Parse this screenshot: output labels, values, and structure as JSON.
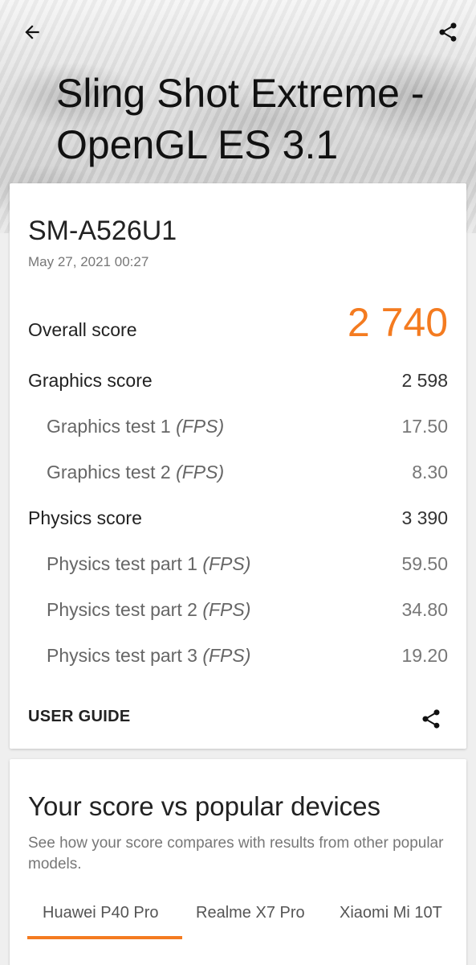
{
  "header": {
    "title": "Sling Shot Extreme - OpenGL ES 3.1",
    "back_icon": "arrow-back-icon",
    "share_icon": "share-icon"
  },
  "result": {
    "device": "SM-A526U1",
    "date": "May 27, 2021 00:27",
    "overall": {
      "label": "Overall score",
      "value": "2 740"
    },
    "graphics": {
      "label": "Graphics score",
      "value": "2 598"
    },
    "graphics_tests": [
      {
        "label": "Graphics test 1",
        "unit": "(FPS)",
        "value": "17.50"
      },
      {
        "label": "Graphics test 2",
        "unit": "(FPS)",
        "value": "8.30"
      }
    ],
    "physics": {
      "label": "Physics score",
      "value": "3 390"
    },
    "physics_tests": [
      {
        "label": "Physics test part 1",
        "unit": "(FPS)",
        "value": "59.50"
      },
      {
        "label": "Physics test part 2",
        "unit": "(FPS)",
        "value": "34.80"
      },
      {
        "label": "Physics test part 3",
        "unit": "(FPS)",
        "value": "19.20"
      }
    ],
    "user_guide": "USER GUIDE"
  },
  "compare": {
    "title": "Your score vs popular devices",
    "description": "See how your score compares with results from other popular models.",
    "tabs": [
      "Huawei P40 Pro",
      "Realme X7 Pro",
      "Xiaomi Mi 10T"
    ]
  },
  "colors": {
    "accent": "#f47b20"
  }
}
